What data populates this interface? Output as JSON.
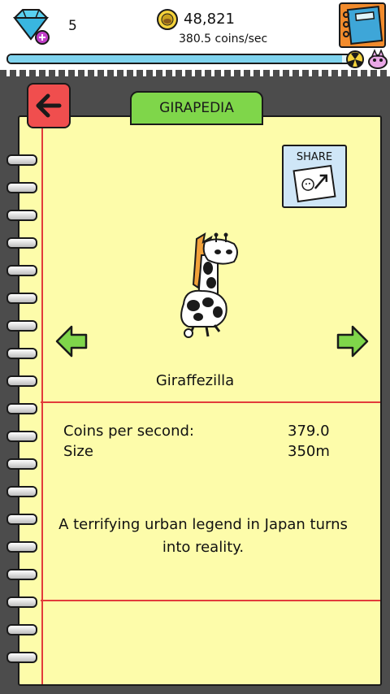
{
  "header": {
    "gem_count": "5",
    "coins_total": "48,821",
    "coins_rate": "380.5 coins/sec",
    "progress": 0.97
  },
  "icons": {
    "gem": "diamond-gem-icon",
    "coin": "coin-icon",
    "book": "book-icon",
    "hazard": "hazard-icon",
    "creature": "creature-icon",
    "back": "back-arrow-icon",
    "prev": "left-arrow-icon",
    "next": "right-arrow-icon"
  },
  "tab": {
    "title": "GIRAPEDIA"
  },
  "share": {
    "label": "SHARE"
  },
  "entry": {
    "name": "Giraffezilla",
    "stats": [
      {
        "label": "Coins per second:",
        "value": "379.0"
      },
      {
        "label": "Size",
        "value": "350m"
      }
    ],
    "description": "A terrifying urban legend in Japan turns into reality."
  },
  "colors": {
    "page": "#fdfcaa",
    "red_line": "#e23b3b",
    "tab_green": "#7fd64a",
    "back_red": "#f04e4e",
    "background": "#4c4c4c"
  }
}
